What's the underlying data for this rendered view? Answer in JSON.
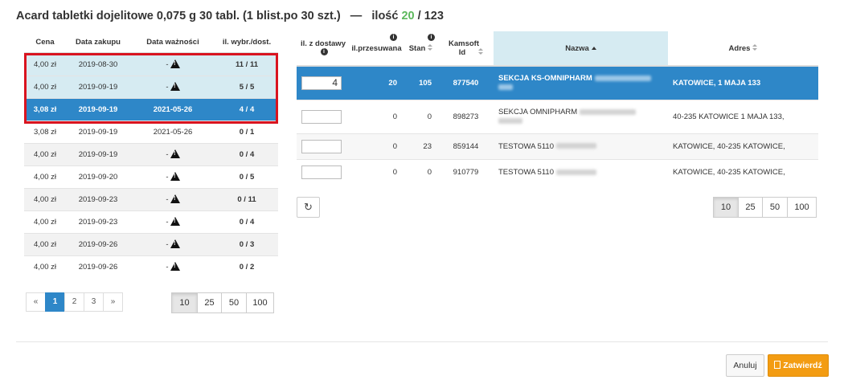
{
  "header": {
    "product": "Acard tabletki dojelitowe 0,075 g 30 tabl. (1 blist.po 30 szt.)",
    "separator": "—",
    "qty_label": "ilość",
    "qty_done": "20",
    "qty_sep": "/",
    "qty_total": "123"
  },
  "left_table": {
    "columns": [
      "Cena",
      "Data zakupu",
      "Data ważności",
      "il. wybr./dost."
    ],
    "rows": [
      {
        "price": "4,00 zł",
        "purchase": "2019-08-30",
        "expiry": "-",
        "warn": true,
        "qty": "11 / 11",
        "state": "sel-light"
      },
      {
        "price": "4,00 zł",
        "purchase": "2019-09-19",
        "expiry": "-",
        "warn": true,
        "qty": "5 / 5",
        "state": "sel-light"
      },
      {
        "price": "3,08 zł",
        "purchase": "2019-09-19",
        "expiry": "2021-05-26",
        "warn": false,
        "qty": "4 / 4",
        "state": "sel-dark"
      },
      {
        "price": "3,08 zł",
        "purchase": "2019-09-19",
        "expiry": "2021-05-26",
        "warn": false,
        "qty": "0 / 1",
        "state": "even"
      },
      {
        "price": "4,00 zł",
        "purchase": "2019-09-19",
        "expiry": "-",
        "warn": true,
        "qty": "0 / 4",
        "state": "odd"
      },
      {
        "price": "4,00 zł",
        "purchase": "2019-09-20",
        "expiry": "-",
        "warn": true,
        "qty": "0 / 5",
        "state": "even"
      },
      {
        "price": "4,00 zł",
        "purchase": "2019-09-23",
        "expiry": "-",
        "warn": true,
        "qty": "0 / 11",
        "state": "odd"
      },
      {
        "price": "4,00 zł",
        "purchase": "2019-09-23",
        "expiry": "-",
        "warn": true,
        "qty": "0 / 4",
        "state": "even"
      },
      {
        "price": "4,00 zł",
        "purchase": "2019-09-26",
        "expiry": "-",
        "warn": true,
        "qty": "0 / 3",
        "state": "odd"
      },
      {
        "price": "4,00 zł",
        "purchase": "2019-09-26",
        "expiry": "-",
        "warn": true,
        "qty": "0 / 2",
        "state": "even"
      }
    ],
    "pager": [
      "«",
      "1",
      "2",
      "3",
      "»"
    ],
    "pager_active": "1",
    "page_sizes": [
      "10",
      "25",
      "50",
      "100"
    ],
    "page_size_active": "10"
  },
  "right_table": {
    "col_il_z_dostawy": "il. z dostawy",
    "col_il_przesuwana": "il.przesuwana",
    "col_stan": "Stan",
    "col_kamsoft": "Kamsoft Id",
    "col_nazwa": "Nazwa",
    "col_adres": "Adres",
    "rows": [
      {
        "input": "4",
        "przesuwana": "20",
        "stan": "105",
        "id": "877540",
        "name": "SEKCJA KS-OMNIPHARM",
        "addr": "KATOWICE, 1 MAJA 133",
        "state": "sel"
      },
      {
        "input": "",
        "przesuwana": "0",
        "stan": "0",
        "id": "898273",
        "name": "SEKCJA OMNIPHARM",
        "addr": "40-235 KATOWICE 1 MAJA 133,",
        "state": "even"
      },
      {
        "input": "",
        "przesuwana": "0",
        "stan": "23",
        "id": "859144",
        "name": "TESTOWA 5110",
        "addr": "KATOWICE, 40-235 KATOWICE,",
        "state": "odd"
      },
      {
        "input": "",
        "przesuwana": "0",
        "stan": "0",
        "id": "910779",
        "name": "TESTOWA 5110",
        "addr": "KATOWICE, 40-235 KATOWICE,",
        "state": "even"
      }
    ],
    "page_sizes": [
      "10",
      "25",
      "50",
      "100"
    ],
    "page_size_active": "10",
    "refresh_icon": "↻"
  },
  "footer": {
    "cancel": "Anuluj",
    "confirm": "Zatwierdź"
  },
  "icons": {
    "warning": "warning-triangle-icon",
    "info": "i"
  },
  "colors": {
    "primary": "#2e87c8",
    "selected_light": "#d6ebf2",
    "highlight_border": "#d9141f",
    "confirm": "#f39c12",
    "qty_done": "#5cb85c"
  }
}
